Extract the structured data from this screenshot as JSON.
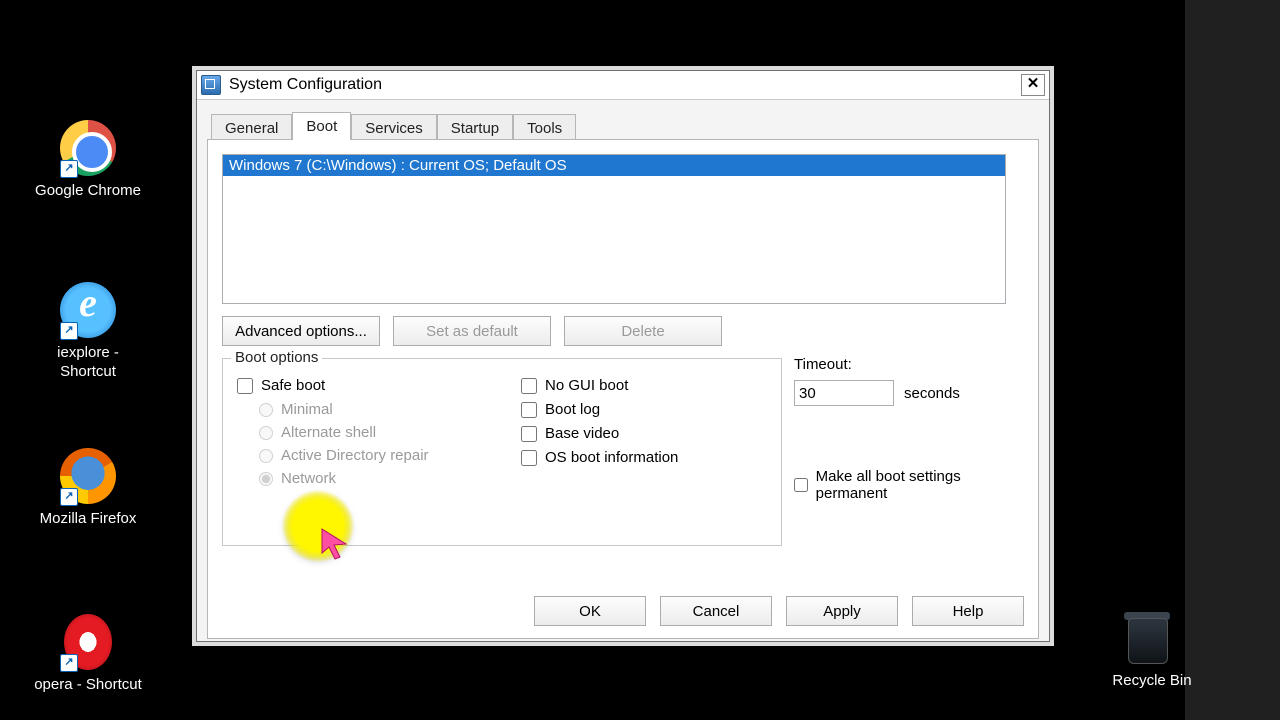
{
  "desktop": {
    "icons": {
      "chrome": "Google Chrome",
      "ie": "iexplore - Shortcut",
      "firefox": "Mozilla Firefox",
      "opera": "opera - Shortcut",
      "recycle": "Recycle Bin"
    }
  },
  "dialog": {
    "title": "System Configuration",
    "tabs": {
      "general": "General",
      "boot": "Boot",
      "services": "Services",
      "startup": "Startup",
      "tools": "Tools"
    },
    "listbox": {
      "entry0": "Windows 7 (C:\\Windows) : Current OS; Default OS"
    },
    "buttons": {
      "advanced": "Advanced options...",
      "setdefault": "Set as default",
      "delete": "Delete",
      "ok": "OK",
      "cancel": "Cancel",
      "apply": "Apply",
      "help": "Help"
    },
    "boot_options": {
      "legend": "Boot options",
      "safe_boot": "Safe boot",
      "minimal": "Minimal",
      "alt_shell": "Alternate shell",
      "ad_repair": "Active Directory repair",
      "network": "Network",
      "no_gui": "No GUI boot",
      "boot_log": "Boot log",
      "base_video": "Base video",
      "os_boot_info": "OS boot information"
    },
    "timeout": {
      "label": "Timeout:",
      "value": "30",
      "unit": "seconds"
    },
    "permanent": "Make all boot settings permanent"
  }
}
